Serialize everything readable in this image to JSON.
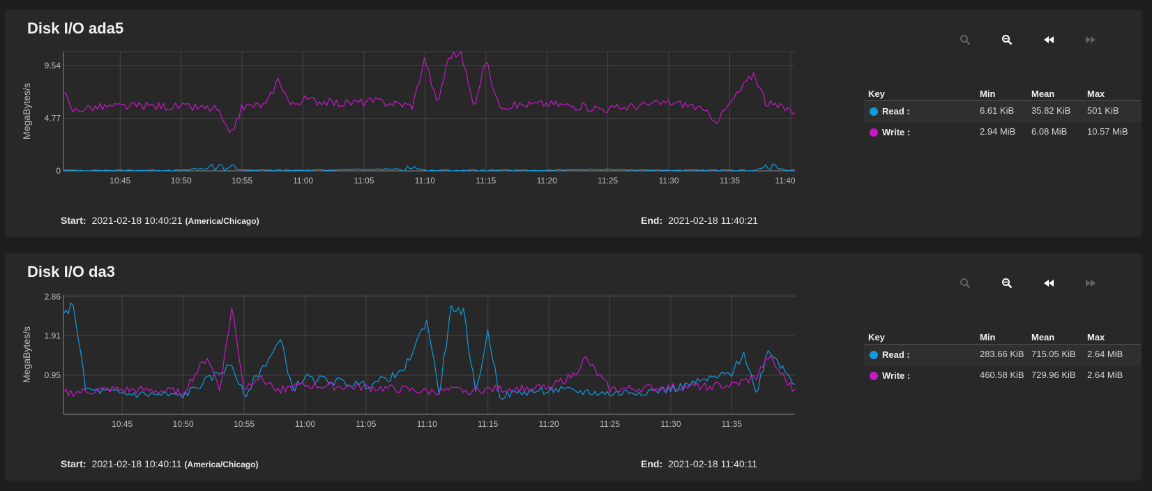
{
  "panels": [
    {
      "title": "Disk I/O ada5",
      "start_label": "Start:",
      "start_value": "2021-02-18 10:40:21",
      "timezone": "(America/Chicago)",
      "end_label": "End:",
      "end_value": "2021-02-18 11:40:21",
      "legend": {
        "headers": [
          "Key",
          "Min",
          "Mean",
          "Max"
        ],
        "rows": [
          {
            "name": "Read :",
            "color": "#0f9be0",
            "min": "6.61 KiB",
            "mean": "35.82 KiB",
            "max": "501 KiB"
          },
          {
            "name": "Write :",
            "color": "#c718c7",
            "min": "2.94 MiB",
            "mean": "6.08 MiB",
            "max": "10.57 MiB"
          }
        ]
      }
    },
    {
      "title": "Disk I/O da3",
      "start_label": "Start:",
      "start_value": "2021-02-18 10:40:11",
      "timezone": "(America/Chicago)",
      "end_label": "End:",
      "end_value": "2021-02-18 11:40:11",
      "legend": {
        "headers": [
          "Key",
          "Min",
          "Mean",
          "Max"
        ],
        "rows": [
          {
            "name": "Read :",
            "color": "#0f9be0",
            "min": "283.66 KiB",
            "mean": "715.05 KiB",
            "max": "2.64 MiB"
          },
          {
            "name": "Write :",
            "color": "#c718c7",
            "min": "460.58 KiB",
            "mean": "729.96 KiB",
            "max": "2.64 MiB"
          }
        ]
      }
    }
  ],
  "toolbar_icons": [
    "zoom-in-icon",
    "zoom-out-icon",
    "step-back-icon",
    "step-forward-icon"
  ],
  "chart_data": [
    {
      "type": "line",
      "title": "Disk I/O ada5",
      "ylabel": "MegaBytes/s",
      "ylim": [
        0,
        10.8
      ],
      "yticks": [
        0,
        4.77,
        9.54
      ],
      "ytick_labels": [
        "0",
        "4.77",
        "9.54"
      ],
      "xlim": [
        "10:40:21",
        "11:40:21"
      ],
      "xticks": [
        "10:45",
        "10:50",
        "10:55",
        "11:00",
        "11:05",
        "11:10",
        "11:15",
        "11:20",
        "11:25",
        "11:30",
        "11:35",
        "11:40"
      ],
      "grid": true,
      "series": [
        {
          "name": "Read",
          "color": "#0f9be0",
          "x": [
            "10:40",
            "10:45",
            "10:50",
            "10:51",
            "10:53",
            "10:54",
            "10:55",
            "10:57",
            "11:00",
            "11:02",
            "11:07",
            "11:09",
            "11:10",
            "11:13",
            "11:20",
            "11:24",
            "11:30",
            "11:37",
            "11:38",
            "11:40"
          ],
          "values": [
            0.05,
            0.05,
            0.05,
            0.15,
            0.25,
            0.4,
            0.1,
            0.05,
            0.05,
            0.1,
            0.15,
            0.3,
            0.05,
            0.05,
            0.05,
            0.15,
            0.05,
            0.05,
            0.35,
            0.05
          ]
        },
        {
          "name": "Write",
          "color": "#c718c7",
          "x": [
            "10:40",
            "10:41",
            "10:42",
            "10:44",
            "10:47",
            "10:50",
            "10:53",
            "10:54",
            "10:55",
            "10:57",
            "10:58",
            "10:59",
            "11:00",
            "11:03",
            "11:06",
            "11:09",
            "11:10",
            "11:11",
            "11:12",
            "11:13",
            "11:14",
            "11:15",
            "11:16",
            "11:17",
            "11:20",
            "11:25",
            "11:30",
            "11:32",
            "11:34",
            "11:36",
            "11:37",
            "11:38",
            "11:40"
          ],
          "values": [
            8.5,
            5.4,
            5.7,
            5.8,
            5.9,
            5.8,
            5.6,
            3.0,
            5.8,
            6.0,
            8.4,
            5.9,
            6.5,
            6.1,
            6.3,
            5.9,
            10.3,
            6.0,
            10.5,
            10.6,
            5.8,
            10.1,
            6.0,
            5.9,
            6.1,
            5.6,
            6.2,
            5.9,
            4.6,
            7.5,
            8.9,
            6.1,
            5.5
          ]
        }
      ]
    },
    {
      "type": "line",
      "title": "Disk I/O da3",
      "ylabel": "MegaBytes/s",
      "ylim": [
        0,
        2.9
      ],
      "yticks": [
        0.95,
        1.91,
        2.86
      ],
      "ytick_labels": [
        "0.95",
        "1.91",
        "2.86"
      ],
      "xlim": [
        "10:40:11",
        "11:40:11"
      ],
      "xticks": [
        "10:45",
        "10:50",
        "10:55",
        "11:00",
        "11:05",
        "11:10",
        "11:15",
        "11:20",
        "11:25",
        "11:30",
        "11:35"
      ],
      "grid": true,
      "series": [
        {
          "name": "Read",
          "color": "#0f9be0",
          "x": [
            "10:40",
            "10:41",
            "10:42",
            "10:45",
            "10:50",
            "10:54",
            "10:55",
            "10:58",
            "10:59",
            "11:00",
            "11:05",
            "11:08",
            "11:10",
            "11:11",
            "11:12",
            "11:13",
            "11:14",
            "11:15",
            "11:16",
            "11:17",
            "11:20",
            "11:25",
            "11:30",
            "11:35",
            "11:36",
            "11:37",
            "11:38",
            "11:40"
          ],
          "values": [
            2.3,
            2.7,
            0.6,
            0.5,
            0.45,
            1.2,
            0.45,
            1.8,
            0.6,
            0.9,
            0.7,
            1.0,
            2.3,
            0.5,
            2.6,
            2.5,
            0.5,
            2.0,
            0.45,
            0.5,
            0.6,
            0.5,
            0.6,
            1.0,
            1.5,
            0.5,
            1.6,
            0.8
          ]
        },
        {
          "name": "Write",
          "color": "#c718c7",
          "x": [
            "10:40",
            "10:44",
            "10:50",
            "10:52",
            "10:53",
            "10:54",
            "10:55",
            "10:56",
            "10:58",
            "11:00",
            "11:05",
            "11:08",
            "11:10",
            "11:15",
            "11:20",
            "11:22",
            "11:23",
            "11:25",
            "11:30",
            "11:35",
            "11:37",
            "11:38",
            "11:40"
          ],
          "values": [
            0.5,
            0.6,
            0.55,
            1.4,
            0.6,
            2.6,
            0.6,
            0.9,
            0.6,
            0.7,
            0.65,
            0.6,
            0.55,
            0.6,
            0.65,
            0.95,
            1.35,
            0.6,
            0.65,
            0.7,
            0.9,
            1.4,
            0.6
          ]
        }
      ]
    }
  ]
}
